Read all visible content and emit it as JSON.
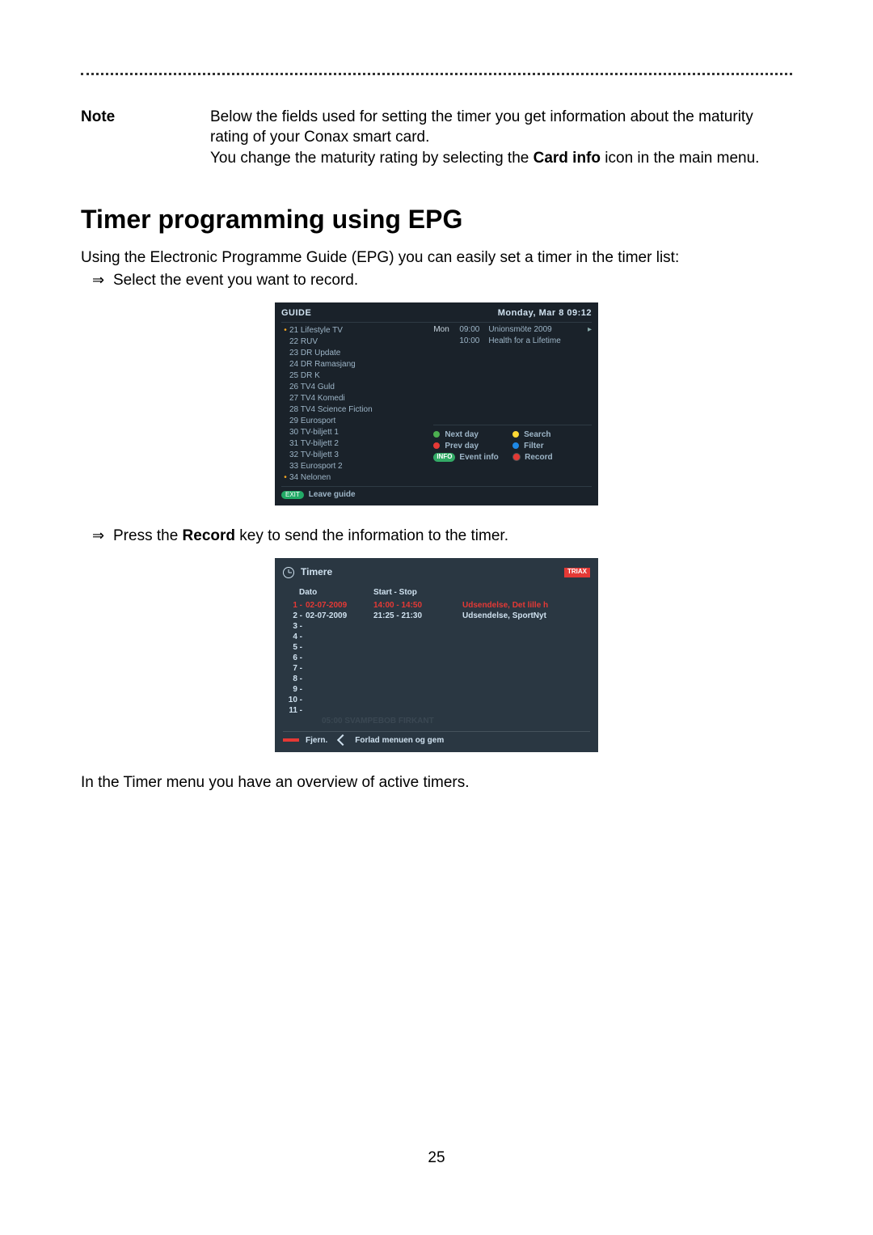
{
  "note": {
    "label": "Note",
    "p1a": "Below the fields used for setting the timer you get information about the maturity rating of your Conax smart card.",
    "p2a": "You change the maturity rating by selecting the ",
    "p2b": "Card info",
    "p2c": " icon in the main menu."
  },
  "heading": "Timer programming using EPG",
  "intro": "Using the Electronic Programme Guide (EPG) you can easily set a timer in the timer list:",
  "bullet1": "Select the event you want to record.",
  "bullet2a": "Press the ",
  "bullet2b": "Record",
  "bullet2c": " key to send the information to the timer.",
  "closing": "In the Timer menu you have an overview of active timers.",
  "pageNumber": "25",
  "epg": {
    "title": "GUIDE",
    "datetime": "Monday, Mar 8  09:12",
    "channels": [
      {
        "dot": true,
        "name": "21 Lifestyle TV"
      },
      {
        "dot": false,
        "name": "22 RUV"
      },
      {
        "dot": false,
        "name": "23 DR Update"
      },
      {
        "dot": false,
        "name": "24 DR Ramasjang"
      },
      {
        "dot": false,
        "name": "25 DR K"
      },
      {
        "dot": false,
        "name": "26 TV4 Guld"
      },
      {
        "dot": false,
        "name": "27 TV4 Komedi"
      },
      {
        "dot": false,
        "name": "28 TV4 Science Fiction"
      },
      {
        "dot": false,
        "name": "29 Eurosport"
      },
      {
        "dot": false,
        "name": "30 TV-biljett 1"
      },
      {
        "dot": false,
        "name": "31 TV-biljett 2"
      },
      {
        "dot": false,
        "name": "32 TV-biljett 3"
      },
      {
        "dot": false,
        "name": "33 Eurosport 2"
      },
      {
        "dot": true,
        "name": "34 Nelonen"
      }
    ],
    "events": [
      {
        "day": "Mon",
        "time": "09:00",
        "title": "Unionsmöte 2009",
        "arrow": true
      },
      {
        "day": "",
        "time": "10:00",
        "title": "Health for a Lifetime",
        "arrow": false
      }
    ],
    "actions": {
      "nextday": "Next day",
      "prevday": "Prev day",
      "search": "Search",
      "filter": "Filter",
      "eventinfo": "Event info",
      "record": "Record"
    },
    "leave": "Leave guide"
  },
  "timerScreen": {
    "title": "Timere",
    "brand": "TRIAX",
    "col_date": "Dato",
    "col_ss": "Start  -  Stop",
    "rows": [
      {
        "n": "1",
        "date": "02-07-2009",
        "ss": "14:00 - 14:50",
        "title": "Udsendelse, Det lille h",
        "sel": true
      },
      {
        "n": "2",
        "date": "02-07-2009",
        "ss": "21:25 - 21:30",
        "title": "Udsendelse, SportNyt",
        "sel": false
      },
      {
        "n": "3",
        "date": "",
        "ss": "",
        "title": "",
        "sel": false
      },
      {
        "n": "4",
        "date": "",
        "ss": "",
        "title": "",
        "sel": false
      },
      {
        "n": "5",
        "date": "",
        "ss": "",
        "title": "",
        "sel": false
      },
      {
        "n": "6",
        "date": "",
        "ss": "",
        "title": "",
        "sel": false
      },
      {
        "n": "7",
        "date": "",
        "ss": "",
        "title": "",
        "sel": false
      },
      {
        "n": "8",
        "date": "",
        "ss": "",
        "title": "",
        "sel": false
      },
      {
        "n": "9",
        "date": "",
        "ss": "",
        "title": "",
        "sel": false
      },
      {
        "n": "10",
        "date": "",
        "ss": "",
        "title": "",
        "sel": false
      },
      {
        "n": "11",
        "date": "",
        "ss": "",
        "title": "",
        "sel": false
      }
    ],
    "ghost": "05:00  SVAMPEBOB FIRKANT",
    "remove": "Fjern.",
    "exit": "Forlad menuen og gem"
  }
}
